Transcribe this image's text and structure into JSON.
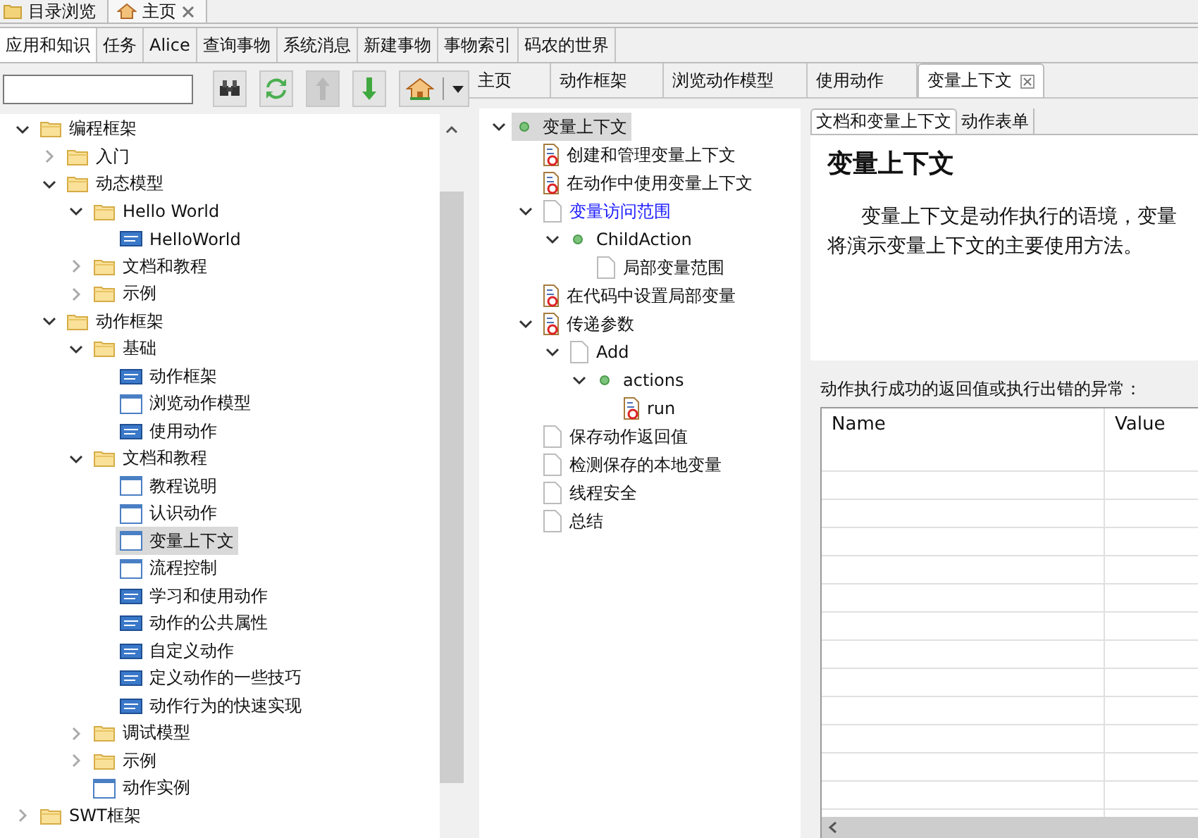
{
  "top_tabs": [
    {
      "label": "目录浏览",
      "kind": "folder",
      "selected": false,
      "closable": false
    },
    {
      "label": "主页",
      "kind": "home",
      "selected": true,
      "closable": true
    }
  ],
  "perspective_tabs": [
    {
      "label": "应用和知识",
      "selected": true
    },
    {
      "label": "任务",
      "selected": false
    },
    {
      "label": "Alice",
      "selected": false
    },
    {
      "label": "查询事物",
      "selected": false
    },
    {
      "label": "系统消息",
      "selected": false
    },
    {
      "label": "新建事物",
      "selected": false
    },
    {
      "label": "事物索引",
      "selected": false
    },
    {
      "label": "码农的世界",
      "selected": false
    }
  ],
  "toolbar": {
    "buttons": [
      {
        "kind": "find",
        "disabled": false
      },
      {
        "kind": "refresh",
        "disabled": false
      },
      {
        "kind": "up",
        "disabled": true
      },
      {
        "kind": "down",
        "disabled": false
      },
      {
        "kind": "home",
        "disabled": false
      }
    ]
  },
  "catalog_tree": [
    {
      "label": "编程框架",
      "kind": "folder",
      "expanded": true,
      "selected": false,
      "children": [
        {
          "label": "入门",
          "kind": "folder",
          "expanded": false,
          "selected": false
        },
        {
          "label": "动态模型",
          "kind": "folder",
          "expanded": true,
          "selected": false,
          "children": [
            {
              "label": "Hello World",
              "kind": "folder",
              "expanded": true,
              "selected": false,
              "children": [
                {
                  "label": "HelloWorld",
                  "kind": "html",
                  "selected": false
                }
              ]
            },
            {
              "label": "文档和教程",
              "kind": "folder",
              "expanded": false,
              "selected": false
            },
            {
              "label": "示例",
              "kind": "folder",
              "expanded": false,
              "selected": false
            }
          ]
        },
        {
          "label": "动作框架",
          "kind": "folder",
          "expanded": true,
          "selected": false,
          "children": [
            {
              "label": "基础",
              "kind": "folder",
              "expanded": true,
              "selected": false,
              "children": [
                {
                  "label": "动作框架",
                  "kind": "html",
                  "selected": false
                },
                {
                  "label": "浏览动作模型",
                  "kind": "window",
                  "selected": false
                },
                {
                  "label": "使用动作",
                  "kind": "html",
                  "selected": false
                }
              ]
            },
            {
              "label": "文档和教程",
              "kind": "folder",
              "expanded": true,
              "selected": false,
              "children": [
                {
                  "label": "教程说明",
                  "kind": "window",
                  "selected": false
                },
                {
                  "label": "认识动作",
                  "kind": "window",
                  "selected": false
                },
                {
                  "label": "变量上下文",
                  "kind": "window",
                  "selected": true
                },
                {
                  "label": "流程控制",
                  "kind": "window",
                  "selected": false
                },
                {
                  "label": "学习和使用动作",
                  "kind": "html",
                  "selected": false
                },
                {
                  "label": "动作的公共属性",
                  "kind": "html",
                  "selected": false
                },
                {
                  "label": "自定义动作",
                  "kind": "html",
                  "selected": false
                },
                {
                  "label": "定义动作的一些技巧",
                  "kind": "html",
                  "selected": false
                },
                {
                  "label": "动作行为的快速实现",
                  "kind": "html",
                  "selected": false
                }
              ]
            },
            {
              "label": "调试模型",
              "kind": "folder",
              "expanded": false,
              "selected": false
            },
            {
              "label": "示例",
              "kind": "folder",
              "expanded": false,
              "selected": false
            },
            {
              "label": "动作实例",
              "kind": "window",
              "selected": false
            }
          ]
        }
      ]
    },
    {
      "label": "SWT框架",
      "kind": "folder",
      "expanded": false,
      "selected": false
    }
  ],
  "editor_tabs": [
    {
      "label": "主页",
      "selected": false,
      "closable": false
    },
    {
      "label": "动作框架",
      "selected": false,
      "closable": false
    },
    {
      "label": "浏览动作模型",
      "selected": false,
      "closable": false
    },
    {
      "label": "使用动作",
      "selected": false,
      "closable": false
    },
    {
      "label": "变量上下文",
      "selected": true,
      "closable": true
    }
  ],
  "outline_tree": [
    {
      "label": "变量上下文",
      "kind": "dot",
      "expanded": true,
      "selected": true,
      "hover": false,
      "children": [
        {
          "label": "创建和管理变量上下文",
          "kind": "action",
          "selected": false,
          "hover": false
        },
        {
          "label": "在动作中使用变量上下文",
          "kind": "action",
          "selected": false,
          "hover": false
        },
        {
          "label": "变量访问范围",
          "kind": "file",
          "expanded": true,
          "selected": false,
          "hover": true,
          "children": [
            {
              "label": "ChildAction",
              "kind": "dot",
              "expanded": true,
              "selected": false,
              "hover": false,
              "children": [
                {
                  "label": "局部变量范围",
                  "kind": "file",
                  "selected": false,
                  "hover": false
                }
              ]
            }
          ]
        },
        {
          "label": "在代码中设置局部变量",
          "kind": "action",
          "selected": false,
          "hover": false
        },
        {
          "label": "传递参数",
          "kind": "action",
          "expanded": true,
          "selected": false,
          "hover": false,
          "children": [
            {
              "label": "Add",
              "kind": "file",
              "expanded": true,
              "selected": false,
              "hover": false,
              "children": [
                {
                  "label": "actions",
                  "kind": "dot",
                  "expanded": true,
                  "selected": false,
                  "hover": false,
                  "children": [
                    {
                      "label": "run",
                      "kind": "action",
                      "selected": false,
                      "hover": false
                    }
                  ]
                }
              ]
            }
          ]
        },
        {
          "label": "保存动作返回值",
          "kind": "file",
          "selected": false,
          "hover": false
        },
        {
          "label": "检测保存的本地变量",
          "kind": "file",
          "selected": false,
          "hover": false
        },
        {
          "label": "线程安全",
          "kind": "file",
          "selected": false,
          "hover": false
        },
        {
          "label": "总结",
          "kind": "file",
          "selected": false,
          "hover": false
        }
      ]
    }
  ],
  "doc_tabs": [
    {
      "label": "文档和变量上下文",
      "selected": true
    },
    {
      "label": "动作表单",
      "selected": false
    }
  ],
  "document": {
    "heading": "变量上下文",
    "lines": [
      "变量上下文是动作执行的语境，变量",
      "将演示变量上下文的主要使用方法。"
    ]
  },
  "result": {
    "label": "动作执行成功的返回值或执行出错的异常：",
    "columns": [
      "Name",
      "Value"
    ]
  }
}
